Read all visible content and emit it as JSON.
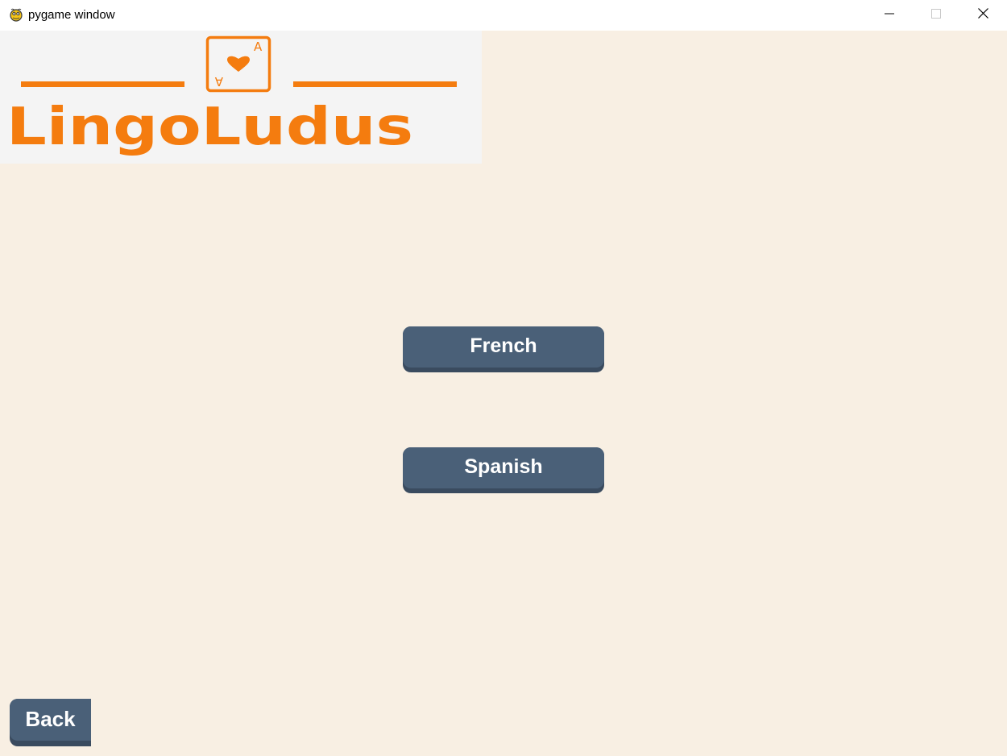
{
  "window": {
    "title": "pygame window",
    "icon": "pygame-snake-icon",
    "controls": {
      "minimize_icon": "minimize-icon",
      "maximize_icon": "maximize-icon",
      "close_icon": "close-icon"
    }
  },
  "logo": {
    "text": "LingoLudus",
    "card_rank": "A",
    "card_suit_icon": "heart-icon",
    "color": "#f47c0f"
  },
  "menu": {
    "buttons": [
      {
        "label": "French"
      },
      {
        "label": "Spanish"
      }
    ]
  },
  "back": {
    "label": "Back"
  },
  "colors": {
    "background": "#f8efe3",
    "logo_panel": "#f4f4f4",
    "button_top": "#4a6078",
    "button_shadow": "#3a4b5f",
    "button_text": "#ffffff"
  }
}
